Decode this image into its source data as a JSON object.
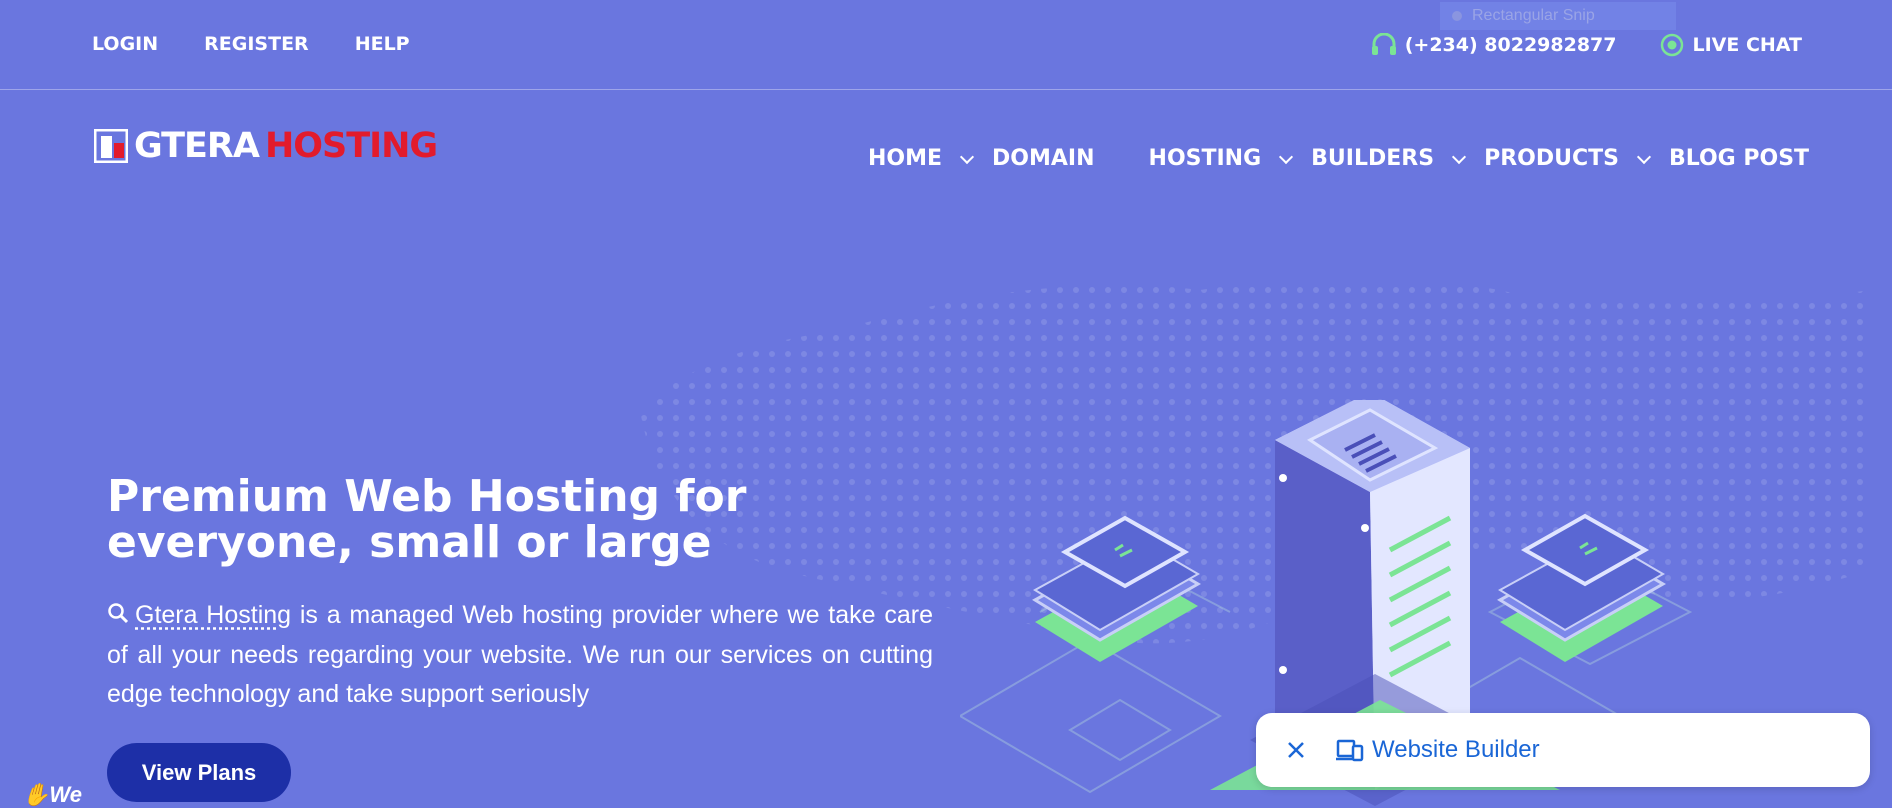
{
  "topbar": {
    "links": [
      "LOGIN",
      "REGISTER",
      "HELP"
    ],
    "phone": "(+234) 8022982877",
    "live_chat": "LIVE CHAT",
    "snip_overlay": "Rectangular Snip"
  },
  "brand": {
    "logo_primary": "GTERA",
    "logo_secondary": "HOSTING"
  },
  "nav": {
    "items": [
      "HOME",
      "DOMAIN",
      "HOSTING",
      "BUILDERS",
      "PRODUCTS",
      "BLOG POST"
    ]
  },
  "hero": {
    "title": "Premium Web Hosting for everyone, small or large",
    "desc_link": "Gtera Hosting",
    "desc_rest": " is a managed Web hosting provider where we take care of all your needs regarding your website. We run our services on cutting edge technology and take support seriously",
    "button": "View Plans",
    "wave_text": "We"
  },
  "toast": {
    "label": "Website Builder"
  },
  "colors": {
    "background": "#6a76df",
    "logo_red": "#e21b2c",
    "button": "#1d2fa7",
    "toast_text": "#1a66d6",
    "accent_green": "#7be495"
  }
}
